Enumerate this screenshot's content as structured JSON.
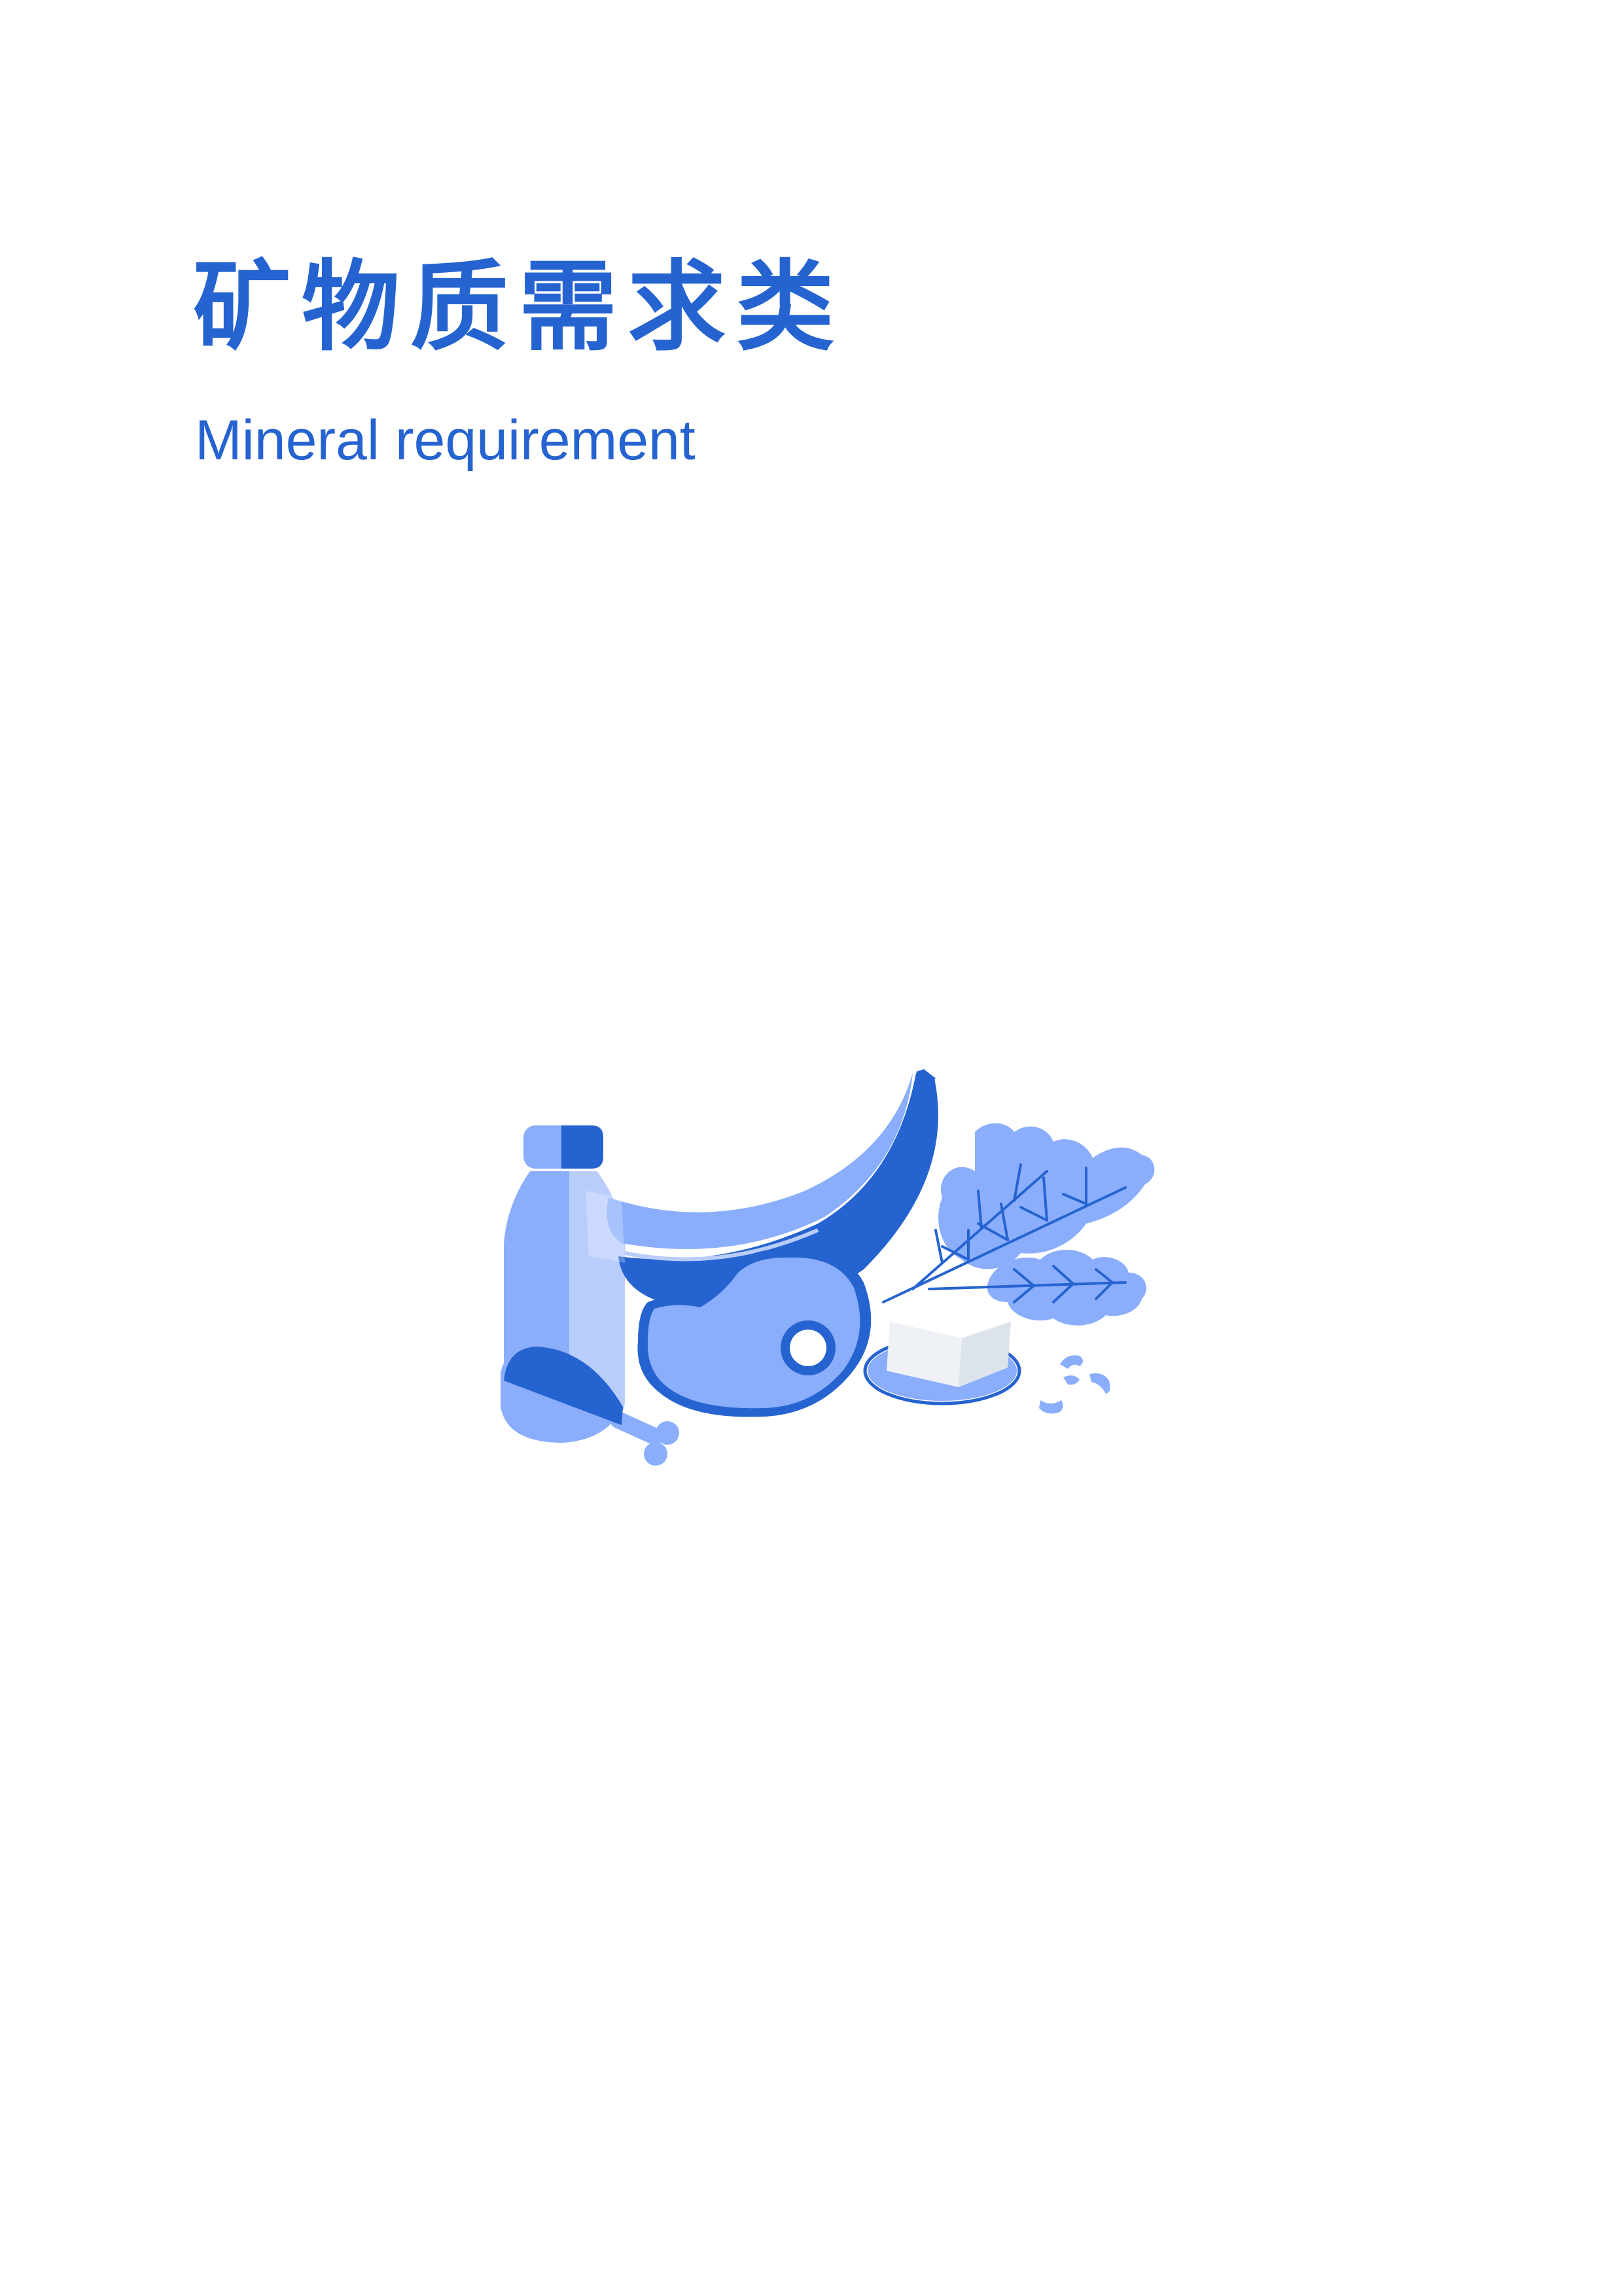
{
  "page": {
    "title_cn": "矿物质需求类",
    "title_en": "Mineral requirement"
  },
  "illustration": {
    "subject": "food-illustration",
    "items": [
      "bottle-icon",
      "banana-icon",
      "chicken-leg-icon",
      "steak-icon",
      "spinach-leaves-icon",
      "tofu-icon",
      "nuts-icon"
    ]
  },
  "colors": {
    "accent": "#2563d0",
    "mid_blue": "#8aaefc",
    "light_blue": "#b9cdfd",
    "tofu_white": "#eef1f5",
    "background": "#ffffff"
  }
}
